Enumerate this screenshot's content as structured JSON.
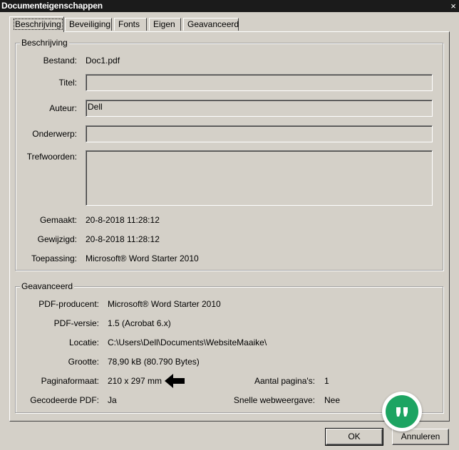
{
  "window": {
    "title": "Documenteigenschappen",
    "close_glyph": "×"
  },
  "tabs": [
    {
      "label": "Beschrijving",
      "active": true
    },
    {
      "label": "Beveiliging"
    },
    {
      "label": "Fonts"
    },
    {
      "label": "Eigen"
    },
    {
      "label": "Geavanceerd"
    }
  ],
  "description": {
    "legend": "Beschrijving",
    "bestand_label": "Bestand:",
    "bestand_value": "Doc1.pdf",
    "titel_label": "Titel:",
    "titel_value": "",
    "auteur_label": "Auteur:",
    "auteur_value": "Dell",
    "onderwerp_label": "Onderwerp:",
    "onderwerp_value": "",
    "trefwoorden_label": "Trefwoorden:",
    "trefwoorden_value": "",
    "gemaakt_label": "Gemaakt:",
    "gemaakt_value": "20-8-2018 11:28:12",
    "gewijzigd_label": "Gewijzigd:",
    "gewijzigd_value": "20-8-2018 11:28:12",
    "toepassing_label": "Toepassing:",
    "toepassing_value": "Microsoft® Word Starter 2010"
  },
  "advanced": {
    "legend": "Geavanceerd",
    "producer_label": "PDF-producent:",
    "producer_value": "Microsoft® Word Starter 2010",
    "version_label": "PDF-versie:",
    "version_value": "1.5 (Acrobat 6.x)",
    "location_label": "Locatie:",
    "location_value": "C:\\Users\\Dell\\Documents\\WebsiteMaaike\\",
    "size_label": "Grootte:",
    "size_value": "78,90 kB (80.790 Bytes)",
    "pagesize_label": "Paginaformaat:",
    "pagesize_value": "210 x 297 mm",
    "pages_label": "Aantal pagina's:",
    "pages_value": "1",
    "tagged_label": "Gecodeerde PDF:",
    "tagged_value": "Ja",
    "fastweb_label": "Snelle webweergave:",
    "fastweb_value": "Nee"
  },
  "buttons": {
    "ok": "OK",
    "cancel": "Annuleren"
  },
  "icons": {
    "arrow": "pointing-arrow-icon",
    "quote": "quote-bubble-icon"
  },
  "colors": {
    "dialog": "#d4d0c8",
    "titlebar": "#1b1b1b",
    "quote_green": "#1da462"
  }
}
